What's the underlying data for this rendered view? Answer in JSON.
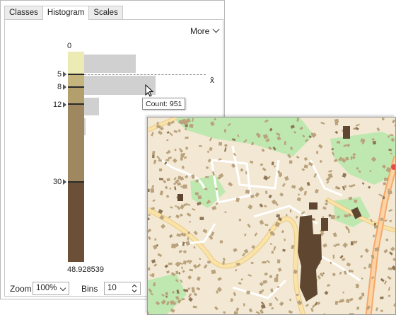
{
  "tabs": [
    {
      "label": "Classes"
    },
    {
      "label": "Histogram"
    },
    {
      "label": "Scales"
    }
  ],
  "more_menu": {
    "label": "More"
  },
  "histogram": {
    "min_label": "0",
    "max_label": "48.928539",
    "mean_label": "x̄",
    "breaks": [
      {
        "label": "5",
        "value": 5
      },
      {
        "label": "8",
        "value": 8
      },
      {
        "label": "12",
        "value": 12
      },
      {
        "label": "30",
        "value": 30
      }
    ],
    "class_colors": [
      "#ecebb3",
      "#c4b47e",
      "#b39f6c",
      "#9f8760",
      "#6b4f36"
    ],
    "bin_fill_fraction": [
      0.41,
      0.57,
      0.12,
      0.01,
      0,
      0,
      0,
      0,
      0,
      0
    ],
    "tooltip": "Count: 951"
  },
  "zoom": {
    "label": "Zoom",
    "value": "100%"
  },
  "bins": {
    "label": "Bins",
    "value": "10"
  },
  "map": {
    "colors": {
      "background": "#f3e8d3",
      "park": "#bfe8b0",
      "road": "#fbe3a8",
      "road_casing": "#e6c987",
      "white_street": "#ffffff",
      "building_light": "#b9a27c",
      "building_dark": "#5f4630",
      "highway": "#f5a96b",
      "marker": "#e84b4b"
    }
  }
}
